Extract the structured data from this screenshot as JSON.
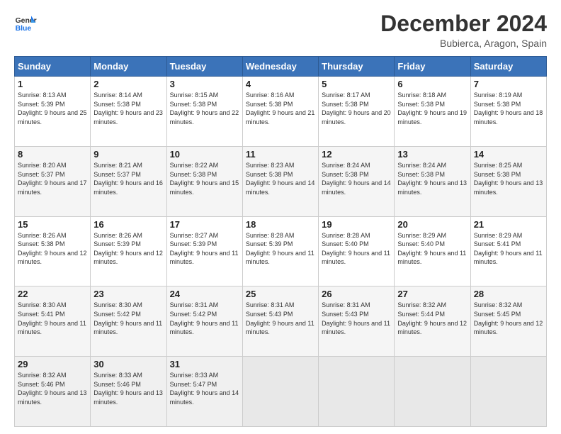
{
  "header": {
    "logo_line1": "General",
    "logo_line2": "Blue",
    "title": "December 2024",
    "subtitle": "Bubierca, Aragon, Spain"
  },
  "calendar": {
    "days_of_week": [
      "Sunday",
      "Monday",
      "Tuesday",
      "Wednesday",
      "Thursday",
      "Friday",
      "Saturday"
    ],
    "weeks": [
      [
        {
          "day": "1",
          "sunrise": "Sunrise: 8:13 AM",
          "sunset": "Sunset: 5:39 PM",
          "daylight": "Daylight: 9 hours and 25 minutes."
        },
        {
          "day": "2",
          "sunrise": "Sunrise: 8:14 AM",
          "sunset": "Sunset: 5:38 PM",
          "daylight": "Daylight: 9 hours and 23 minutes."
        },
        {
          "day": "3",
          "sunrise": "Sunrise: 8:15 AM",
          "sunset": "Sunset: 5:38 PM",
          "daylight": "Daylight: 9 hours and 22 minutes."
        },
        {
          "day": "4",
          "sunrise": "Sunrise: 8:16 AM",
          "sunset": "Sunset: 5:38 PM",
          "daylight": "Daylight: 9 hours and 21 minutes."
        },
        {
          "day": "5",
          "sunrise": "Sunrise: 8:17 AM",
          "sunset": "Sunset: 5:38 PM",
          "daylight": "Daylight: 9 hours and 20 minutes."
        },
        {
          "day": "6",
          "sunrise": "Sunrise: 8:18 AM",
          "sunset": "Sunset: 5:38 PM",
          "daylight": "Daylight: 9 hours and 19 minutes."
        },
        {
          "day": "7",
          "sunrise": "Sunrise: 8:19 AM",
          "sunset": "Sunset: 5:38 PM",
          "daylight": "Daylight: 9 hours and 18 minutes."
        }
      ],
      [
        {
          "day": "8",
          "sunrise": "Sunrise: 8:20 AM",
          "sunset": "Sunset: 5:37 PM",
          "daylight": "Daylight: 9 hours and 17 minutes."
        },
        {
          "day": "9",
          "sunrise": "Sunrise: 8:21 AM",
          "sunset": "Sunset: 5:37 PM",
          "daylight": "Daylight: 9 hours and 16 minutes."
        },
        {
          "day": "10",
          "sunrise": "Sunrise: 8:22 AM",
          "sunset": "Sunset: 5:38 PM",
          "daylight": "Daylight: 9 hours and 15 minutes."
        },
        {
          "day": "11",
          "sunrise": "Sunrise: 8:23 AM",
          "sunset": "Sunset: 5:38 PM",
          "daylight": "Daylight: 9 hours and 14 minutes."
        },
        {
          "day": "12",
          "sunrise": "Sunrise: 8:24 AM",
          "sunset": "Sunset: 5:38 PM",
          "daylight": "Daylight: 9 hours and 14 minutes."
        },
        {
          "day": "13",
          "sunrise": "Sunrise: 8:24 AM",
          "sunset": "Sunset: 5:38 PM",
          "daylight": "Daylight: 9 hours and 13 minutes."
        },
        {
          "day": "14",
          "sunrise": "Sunrise: 8:25 AM",
          "sunset": "Sunset: 5:38 PM",
          "daylight": "Daylight: 9 hours and 13 minutes."
        }
      ],
      [
        {
          "day": "15",
          "sunrise": "Sunrise: 8:26 AM",
          "sunset": "Sunset: 5:38 PM",
          "daylight": "Daylight: 9 hours and 12 minutes."
        },
        {
          "day": "16",
          "sunrise": "Sunrise: 8:26 AM",
          "sunset": "Sunset: 5:39 PM",
          "daylight": "Daylight: 9 hours and 12 minutes."
        },
        {
          "day": "17",
          "sunrise": "Sunrise: 8:27 AM",
          "sunset": "Sunset: 5:39 PM",
          "daylight": "Daylight: 9 hours and 11 minutes."
        },
        {
          "day": "18",
          "sunrise": "Sunrise: 8:28 AM",
          "sunset": "Sunset: 5:39 PM",
          "daylight": "Daylight: 9 hours and 11 minutes."
        },
        {
          "day": "19",
          "sunrise": "Sunrise: 8:28 AM",
          "sunset": "Sunset: 5:40 PM",
          "daylight": "Daylight: 9 hours and 11 minutes."
        },
        {
          "day": "20",
          "sunrise": "Sunrise: 8:29 AM",
          "sunset": "Sunset: 5:40 PM",
          "daylight": "Daylight: 9 hours and 11 minutes."
        },
        {
          "day": "21",
          "sunrise": "Sunrise: 8:29 AM",
          "sunset": "Sunset: 5:41 PM",
          "daylight": "Daylight: 9 hours and 11 minutes."
        }
      ],
      [
        {
          "day": "22",
          "sunrise": "Sunrise: 8:30 AM",
          "sunset": "Sunset: 5:41 PM",
          "daylight": "Daylight: 9 hours and 11 minutes."
        },
        {
          "day": "23",
          "sunrise": "Sunrise: 8:30 AM",
          "sunset": "Sunset: 5:42 PM",
          "daylight": "Daylight: 9 hours and 11 minutes."
        },
        {
          "day": "24",
          "sunrise": "Sunrise: 8:31 AM",
          "sunset": "Sunset: 5:42 PM",
          "daylight": "Daylight: 9 hours and 11 minutes."
        },
        {
          "day": "25",
          "sunrise": "Sunrise: 8:31 AM",
          "sunset": "Sunset: 5:43 PM",
          "daylight": "Daylight: 9 hours and 11 minutes."
        },
        {
          "day": "26",
          "sunrise": "Sunrise: 8:31 AM",
          "sunset": "Sunset: 5:43 PM",
          "daylight": "Daylight: 9 hours and 11 minutes."
        },
        {
          "day": "27",
          "sunrise": "Sunrise: 8:32 AM",
          "sunset": "Sunset: 5:44 PM",
          "daylight": "Daylight: 9 hours and 12 minutes."
        },
        {
          "day": "28",
          "sunrise": "Sunrise: 8:32 AM",
          "sunset": "Sunset: 5:45 PM",
          "daylight": "Daylight: 9 hours and 12 minutes."
        }
      ],
      [
        {
          "day": "29",
          "sunrise": "Sunrise: 8:32 AM",
          "sunset": "Sunset: 5:46 PM",
          "daylight": "Daylight: 9 hours and 13 minutes."
        },
        {
          "day": "30",
          "sunrise": "Sunrise: 8:33 AM",
          "sunset": "Sunset: 5:46 PM",
          "daylight": "Daylight: 9 hours and 13 minutes."
        },
        {
          "day": "31",
          "sunrise": "Sunrise: 8:33 AM",
          "sunset": "Sunset: 5:47 PM",
          "daylight": "Daylight: 9 hours and 14 minutes."
        },
        null,
        null,
        null,
        null
      ]
    ]
  }
}
